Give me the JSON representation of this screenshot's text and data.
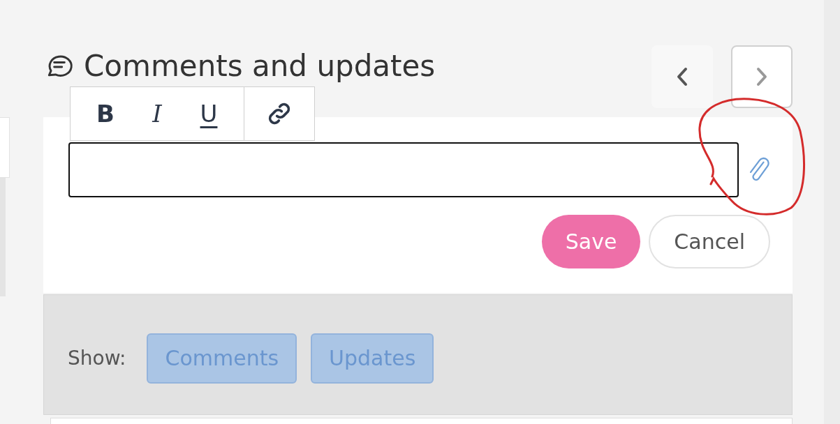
{
  "header": {
    "title": "Comments and updates"
  },
  "format_toolbar": {
    "buttons": [
      {
        "kind": "bold",
        "label": "B"
      },
      {
        "kind": "italic",
        "label": "I"
      },
      {
        "kind": "underline",
        "label": "U"
      },
      {
        "kind": "link"
      }
    ]
  },
  "editor": {
    "actions": [
      {
        "kind": "primary",
        "label": "Save"
      },
      {
        "kind": "secondary",
        "label": "Cancel"
      }
    ]
  },
  "filter": {
    "label": "Show:",
    "toggles": [
      {
        "label": "Comments",
        "selected": true
      },
      {
        "label": "Updates",
        "selected": true
      }
    ]
  }
}
